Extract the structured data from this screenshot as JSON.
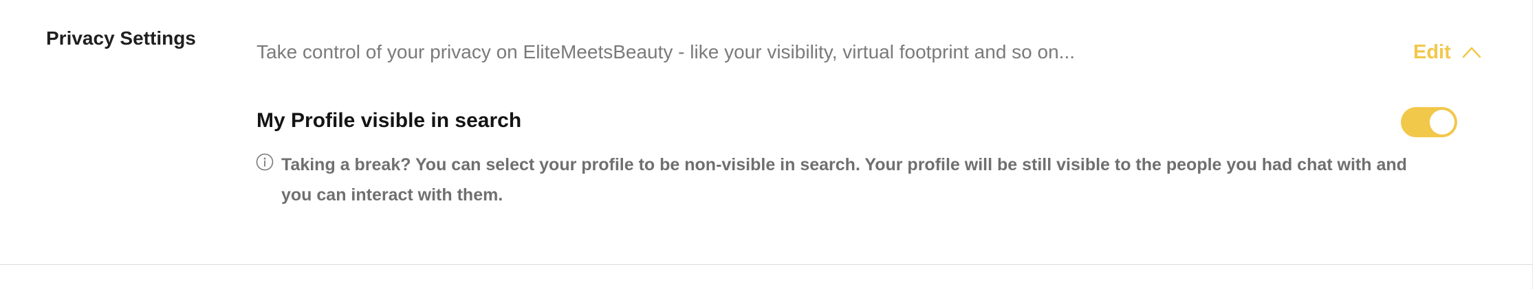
{
  "section": {
    "title": "Privacy Settings",
    "description": "Take control of your privacy on EliteMeetsBeauty - like your visibility, virtual footprint and so on...",
    "edit_label": "Edit"
  },
  "setting": {
    "label": "My Profile visible in search",
    "enabled": true,
    "info_text": "Taking a break? You can select your profile to be non-visible in search. Your profile will be still visible to the people you had chat with and you can interact with them."
  },
  "colors": {
    "accent": "#f2c84b",
    "muted_text": "#7a7a7a",
    "heading_text": "#1f1f1f",
    "divider": "#dcdcdc"
  },
  "icons": {
    "edit_chevron": "chevron-up-icon",
    "info": "info-icon"
  }
}
